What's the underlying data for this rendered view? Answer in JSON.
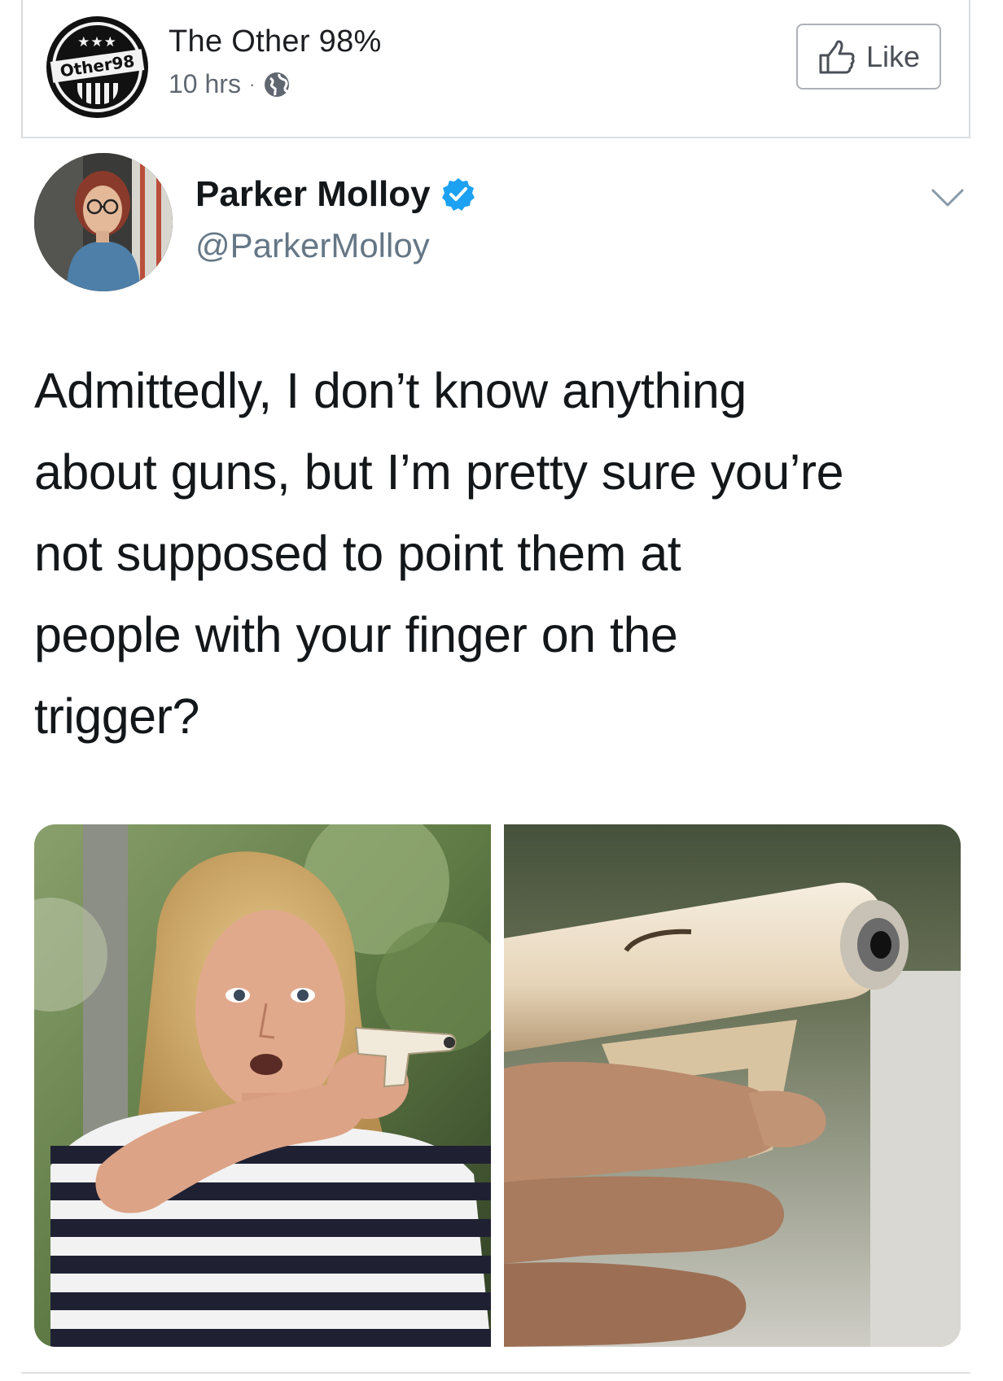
{
  "facebook_post": {
    "page_name": "The Other 98%",
    "avatar_text": "Other98",
    "timestamp": "10 hrs",
    "separator": "·",
    "audience_icon": "globe-icon",
    "like_button_label": "Like",
    "like_icon": "thumbs-up-icon"
  },
  "tweet": {
    "display_name": "Parker Molloy",
    "verified": true,
    "verified_color": "#1da1f2",
    "handle": "@ParkerMolloy",
    "text_lines": [
      "Admittedly, I don’t know anything",
      "about guns, but I’m pretty sure you’re",
      "not supposed to point them at",
      "people with your finger on the",
      "trigger?"
    ],
    "menu_icon": "chevron-down-icon"
  },
  "media": {
    "image_count": 2
  }
}
